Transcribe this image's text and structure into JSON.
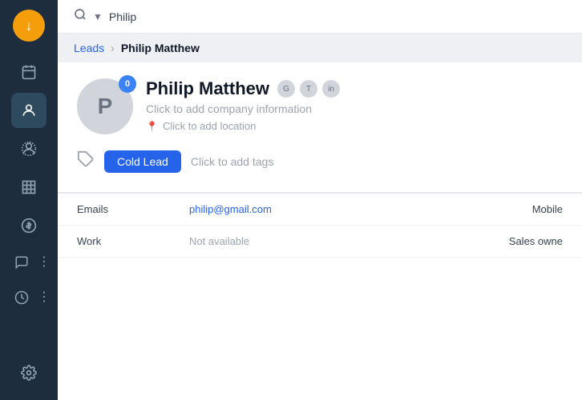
{
  "app": {
    "logo": "↓",
    "logo_bg": "#f59e0b"
  },
  "sidebar": {
    "items": [
      {
        "id": "calendar",
        "icon": "📅",
        "active": false
      },
      {
        "id": "contacts",
        "icon": "👤",
        "active": true
      },
      {
        "id": "person",
        "icon": "🧑",
        "active": false
      },
      {
        "id": "building",
        "icon": "🏢",
        "active": false
      },
      {
        "id": "dollar",
        "icon": "💲",
        "active": false
      },
      {
        "id": "chat",
        "icon": "💬",
        "active": false
      },
      {
        "id": "clock",
        "icon": "🕐",
        "active": false
      }
    ],
    "bottom": [
      {
        "id": "settings",
        "icon": "⚙️"
      }
    ]
  },
  "topbar": {
    "search_placeholder": "Philip",
    "search_value": "Philip"
  },
  "breadcrumb": {
    "parent": "Leads",
    "separator": "›",
    "current": "Philip Matthew"
  },
  "profile": {
    "avatar_letter": "P",
    "badge_count": "0",
    "name": "Philip Matthew",
    "company_placeholder": "Click to add company information",
    "location_placeholder": "Click to add location",
    "location_icon": "📍",
    "social_icons": [
      "G",
      "T",
      "in"
    ]
  },
  "tags": {
    "tag_icon": "🏷",
    "cold_lead_label": "Cold Lead",
    "add_tags_placeholder": "Click to add tags"
  },
  "info_rows": [
    {
      "label": "Emails",
      "value": "philip@gmail.com",
      "value_type": "link",
      "right_label": "Mobile"
    },
    {
      "label": "Work",
      "value": "Not available",
      "value_type": "muted",
      "right_label": "Sales owne"
    }
  ]
}
